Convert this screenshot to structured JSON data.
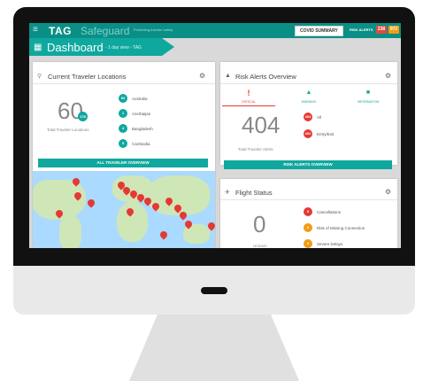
{
  "app": {
    "logo_tag": "TAG",
    "logo_safeguard": "Safeguard",
    "tagline": "Protecting traveler safety",
    "menu_icon": "hamburger-icon"
  },
  "header": {
    "covid_button": "COVID SUMMARY",
    "risk_alerts_label": "RISK ALERTS",
    "badge_critical": "238",
    "badge_warning": "972"
  },
  "dashboard": {
    "title": "Dashboard",
    "subtitle": "- 1 day view - TAG"
  },
  "locations": {
    "title": "Current Traveler Locations",
    "total": "60",
    "total_badge": "178",
    "total_label": "Total Traveler Locations",
    "rows": [
      {
        "count": "94",
        "name": "Australia",
        "color": "#0fa89e"
      },
      {
        "count": "1",
        "name": "Azerbaijan",
        "color": "#0fa89e"
      },
      {
        "count": "4",
        "name": "Bangladesh",
        "color": "#0fa89e"
      },
      {
        "count": "5",
        "name": "Cambodia",
        "color": "#0fa89e"
      }
    ],
    "button": "ALL TRAVELER OVERVIEW"
  },
  "risk": {
    "title": "Risk Alerts Overview",
    "tabs": [
      {
        "label": "CRITICAL",
        "icon": "!",
        "color": "#e53935"
      },
      {
        "label": "WARNING",
        "icon": "▲",
        "color": "#0fa89e"
      },
      {
        "label": "INFORMATION",
        "icon": "■",
        "color": "#0fa89e"
      }
    ],
    "total": "404",
    "total_label": "Total Traveler Alerts",
    "rows": [
      {
        "count": "404",
        "name": "All",
        "color": "#e53935"
      },
      {
        "count": "402",
        "name": "Entry/Exit",
        "color": "#e53935"
      }
    ],
    "button": "RISK ALERTS OVERVIEW"
  },
  "flight": {
    "title": "Flight Status",
    "total": "0",
    "total_label": "Unicorn",
    "rows": [
      {
        "count": "0",
        "name": "Cancellations",
        "color": "#e53935"
      },
      {
        "count": "0",
        "name": "Risk of Missing Connection",
        "color": "#f39c12"
      },
      {
        "count": "0",
        "name": "Severe Delays",
        "color": "#f39c12"
      }
    ]
  }
}
